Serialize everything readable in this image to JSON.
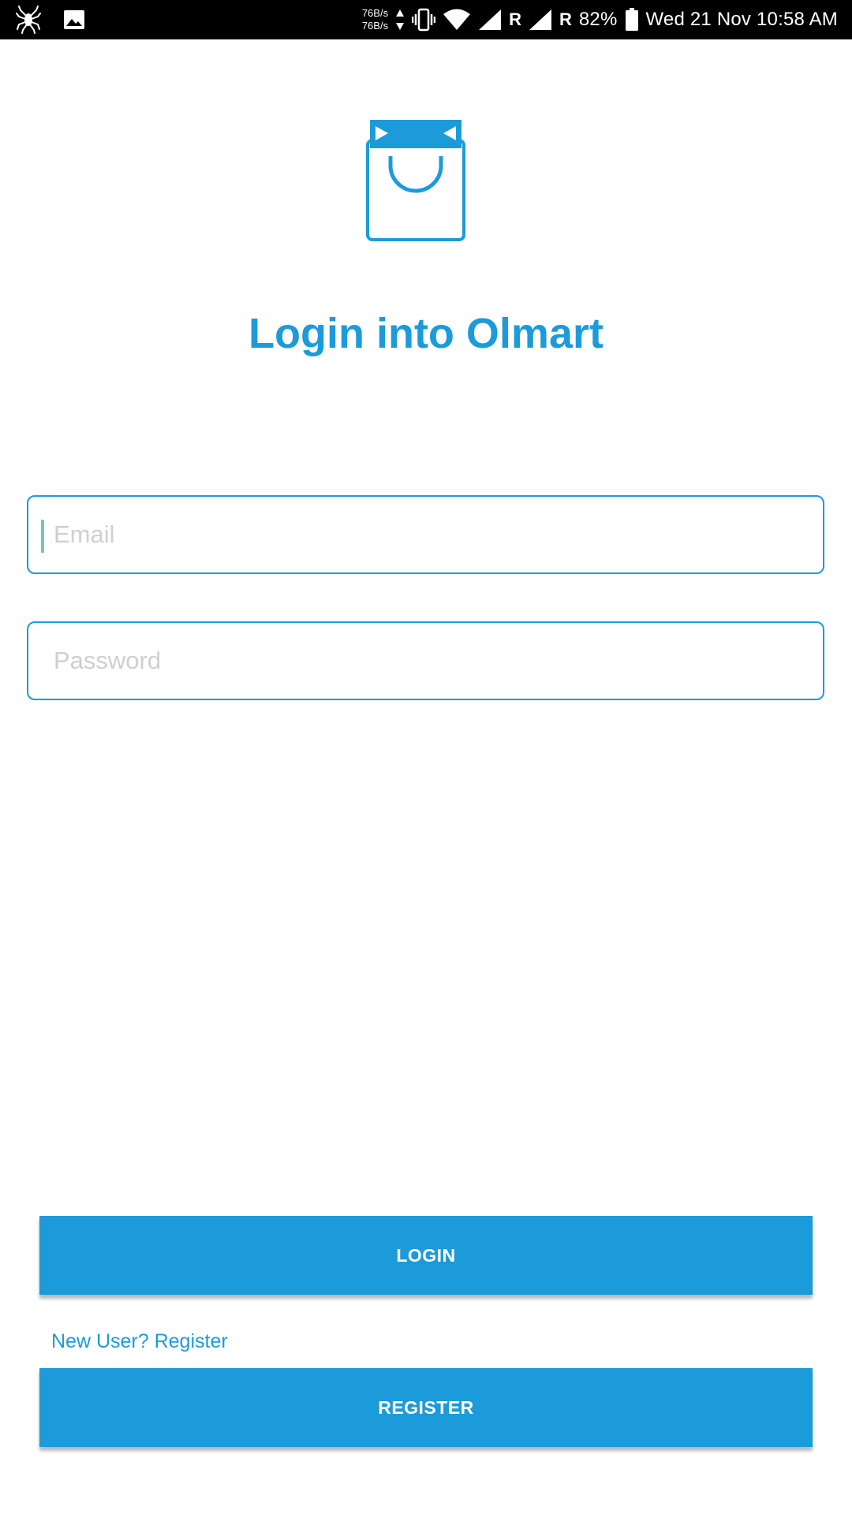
{
  "status_bar": {
    "net_speed_up": "76B/s",
    "net_speed_down": "76B/s",
    "network_type_1": "R",
    "network_type_2": "R",
    "battery_percent": "82%",
    "datetime": "Wed 21 Nov 10:58 AM",
    "icons": [
      "spider-icon",
      "gallery-icon",
      "data-arrows-icon",
      "vibrate-icon",
      "wifi-icon",
      "signal-icon",
      "signal-icon",
      "battery-icon"
    ]
  },
  "logo": {
    "icon": "shopping-bag-icon",
    "color": "#1c9bdb"
  },
  "title": "Login into Olmart",
  "form": {
    "email_placeholder": "Email",
    "email_value": "",
    "password_placeholder": "Password",
    "password_value": ""
  },
  "buttons": {
    "login_label": "LOGIN",
    "register_label": "REGISTER"
  },
  "register_link": "New User? Register",
  "colors": {
    "accent": "#1c9bdb",
    "placeholder": "#cfcfcf",
    "cursor": "#6fc9bd",
    "status_bar_bg": "#000000"
  }
}
